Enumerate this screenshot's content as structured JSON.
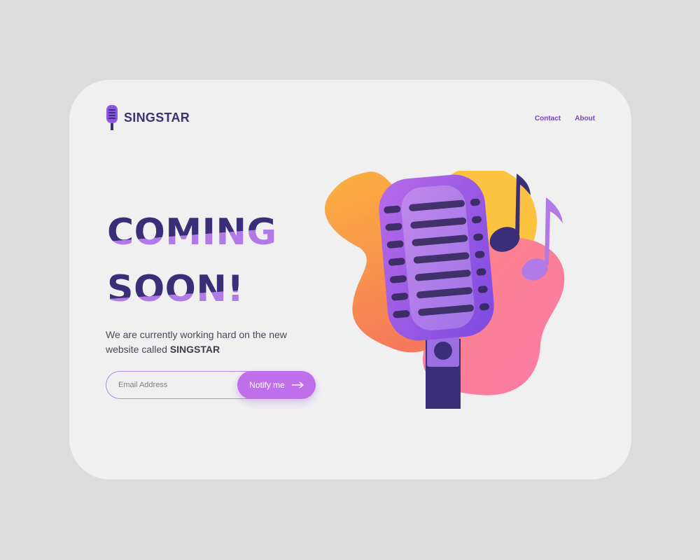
{
  "brand": {
    "name": "SINGSTAR",
    "icon": "microphone-icon"
  },
  "nav": [
    {
      "label": "Contact"
    },
    {
      "label": "About"
    }
  ],
  "hero": {
    "line1": "COMING",
    "line2": "SOON!",
    "description_prefix": "We are currently working hard on the new website called ",
    "description_brand": "SINGSTAR"
  },
  "form": {
    "email_placeholder": "Email Address",
    "button_label": "Notify me",
    "button_icon": "arrow-right-icon"
  },
  "colors": {
    "background": "#dcdcdc",
    "card": "#f0f0f1",
    "headline_dark": "#3a2e79",
    "headline_light": "#b17ae6",
    "accent": "#be6fe9",
    "nav": "#7c3fd9"
  },
  "illustration": {
    "icons": [
      "microphone-icon",
      "music-note-icon",
      "music-note-icon"
    ]
  }
}
